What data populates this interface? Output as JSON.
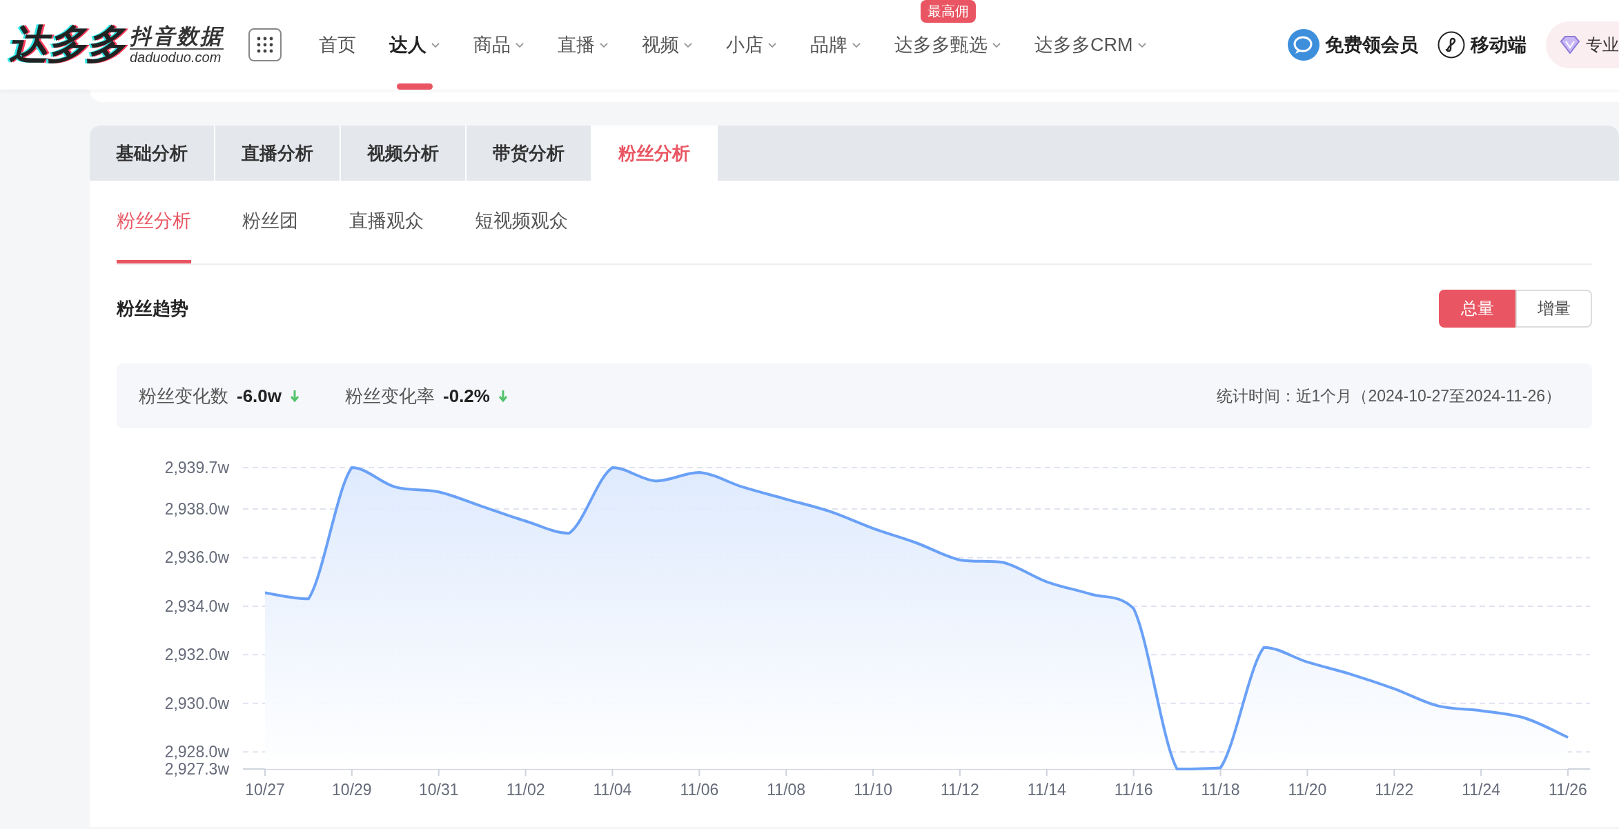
{
  "header": {
    "logo": {
      "mark": "达多多",
      "title": "抖音数据",
      "domain": "daduoduo.com"
    },
    "nav": [
      {
        "label": "首页",
        "dropdown": false,
        "selected": false
      },
      {
        "label": "达人",
        "dropdown": true,
        "selected": true
      },
      {
        "label": "商品",
        "dropdown": true,
        "selected": false
      },
      {
        "label": "直播",
        "dropdown": true,
        "selected": false
      },
      {
        "label": "视频",
        "dropdown": true,
        "selected": false
      },
      {
        "label": "小店",
        "dropdown": true,
        "selected": false
      },
      {
        "label": "品牌",
        "dropdown": true,
        "selected": false
      },
      {
        "label": "达多多甄选",
        "dropdown": true,
        "selected": false,
        "badge": "最高佣"
      },
      {
        "label": "达多多CRM",
        "dropdown": true,
        "selected": false
      }
    ],
    "actions": [
      {
        "kind": "member",
        "label": "免费领会员"
      },
      {
        "kind": "mobile",
        "label": "移动端"
      },
      {
        "kind": "pro",
        "label": "专业"
      }
    ]
  },
  "tabs": [
    {
      "label": "基础分析",
      "selected": false
    },
    {
      "label": "直播分析",
      "selected": false
    },
    {
      "label": "视频分析",
      "selected": false
    },
    {
      "label": "带货分析",
      "selected": false
    },
    {
      "label": "粉丝分析",
      "selected": true
    }
  ],
  "subtabs": [
    {
      "label": "粉丝分析",
      "selected": true
    },
    {
      "label": "粉丝团",
      "selected": false
    },
    {
      "label": "直播观众",
      "selected": false
    },
    {
      "label": "短视频观众",
      "selected": false
    }
  ],
  "section": {
    "title": "粉丝趋势",
    "toggle": [
      {
        "label": "总量",
        "selected": true
      },
      {
        "label": "增量",
        "selected": false
      }
    ]
  },
  "stats": [
    {
      "label": "粉丝变化数",
      "value": "-6.0w",
      "falling": true
    },
    {
      "label": "粉丝变化率",
      "value": "-0.2%",
      "falling": true
    }
  ],
  "period": "统计时间：近1个月（2024-10-27至2024-11-26）",
  "chart_data": {
    "type": "area",
    "categories": [
      "10/27",
      null,
      "10/29",
      null,
      "10/31",
      null,
      "11/02",
      null,
      "11/04",
      null,
      "11/06",
      null,
      "11/08",
      null,
      "11/10",
      null,
      "11/12",
      null,
      "11/14",
      null,
      "11/16",
      null,
      "11/18",
      null,
      "11/20",
      null,
      "11/22",
      null,
      "11/24",
      null,
      "11/26"
    ],
    "series": [
      {
        "color": "#6aa1f7",
        "values": [
          2934.55,
          2934.3,
          2939.7,
          2938.9,
          2938.7,
          2938.1,
          2937.5,
          2937.0,
          2939.7,
          2939.15,
          2939.5,
          2938.9,
          2938.4,
          2937.9,
          2937.2,
          2936.6,
          2935.9,
          2935.8,
          2935.0,
          2934.5,
          2933.9,
          2927.3,
          2927.35,
          2932.3,
          2931.7,
          2931.2,
          2930.6,
          2929.9,
          2929.7,
          2929.4,
          2928.6
        ]
      }
    ],
    "ylim": [
      2927.3,
      2939.7
    ],
    "grid": true,
    "yticks": [
      {
        "value": 2927.3,
        "label": "2,927.3w"
      },
      {
        "value": 2928,
        "label": "2,928.0w"
      },
      {
        "value": 2930,
        "label": "2,930.0w"
      },
      {
        "value": 2932,
        "label": "2,932.0w"
      },
      {
        "value": 2934,
        "label": "2,934.0w"
      },
      {
        "value": 2936,
        "label": "2,936.0w"
      },
      {
        "value": 2938,
        "label": "2,938.0w"
      },
      {
        "value": 2939.7,
        "label": "2,939.7w"
      }
    ]
  }
}
